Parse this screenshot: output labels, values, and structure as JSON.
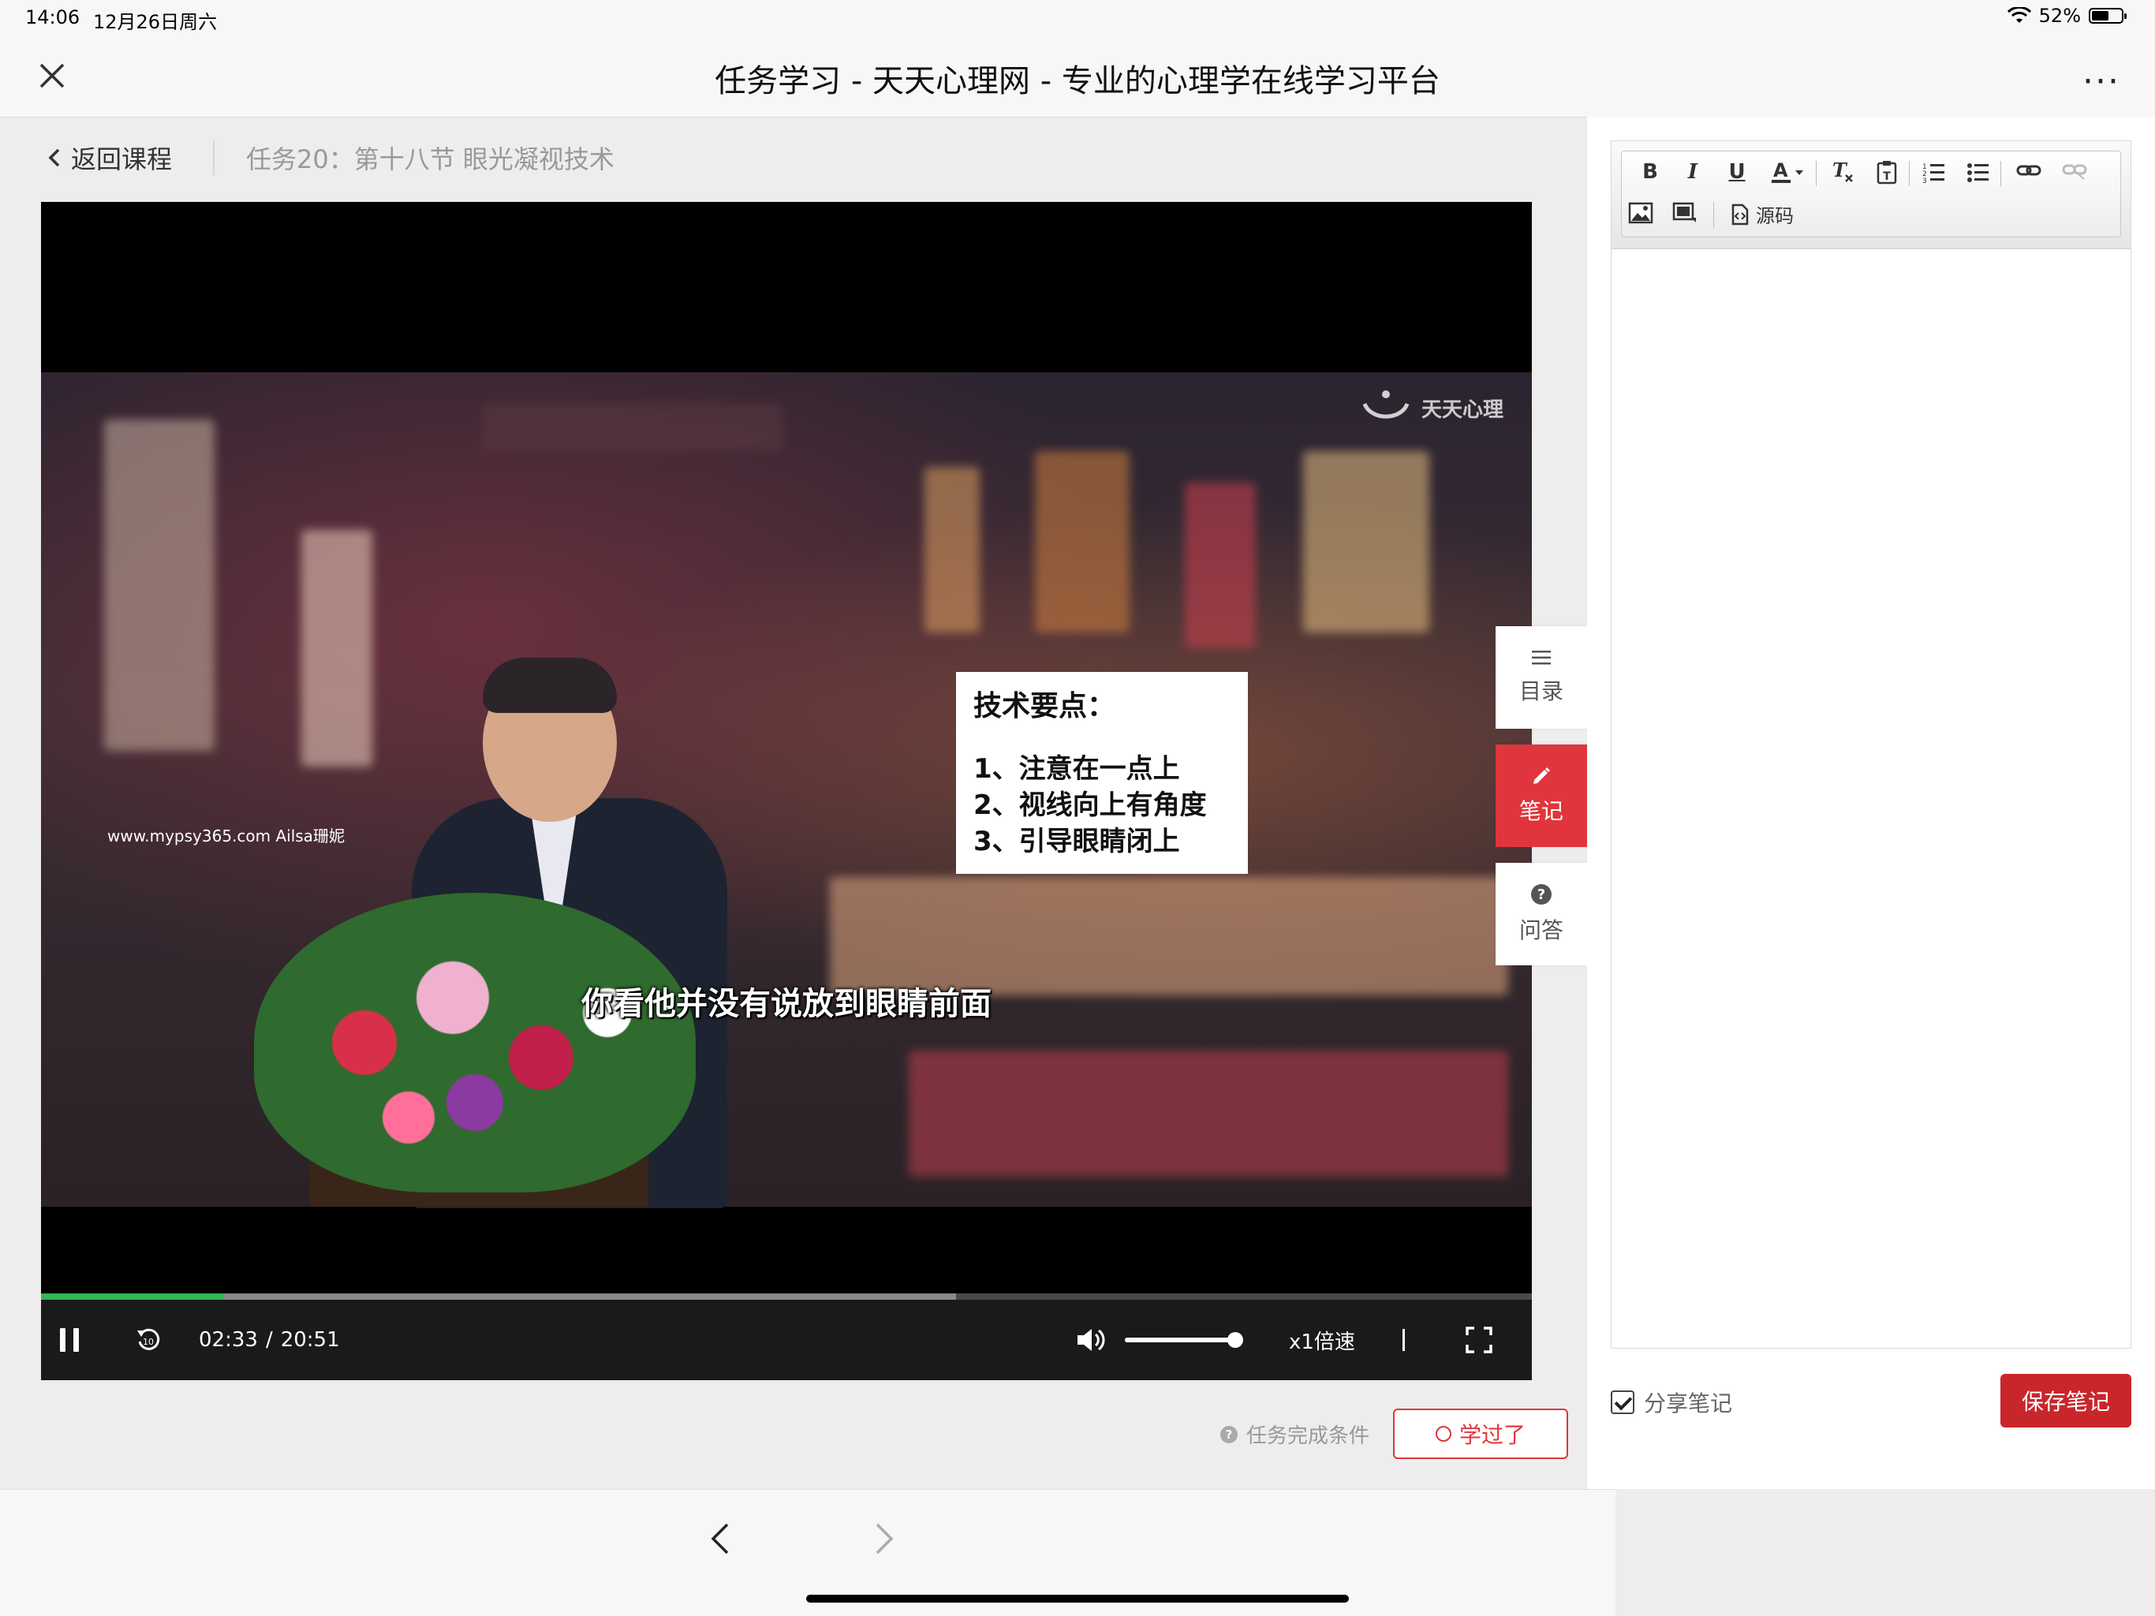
{
  "status": {
    "time": "14:06",
    "date": "12月26日周六",
    "battery": "52%"
  },
  "navbar": {
    "title": "任务学习 - 天天心理网 - 专业的心理学在线学习平台",
    "more": "···"
  },
  "breadcrumb": {
    "back_label": "返回课程",
    "task_title": "任务20：第十八节 眼光凝视技术"
  },
  "video": {
    "logo_text": "天天心理",
    "watermark": "www.mypsy365.com Ailsa珊妮",
    "slide": {
      "heading": "技术要点：",
      "points": [
        "1、注意在一点上",
        "2、视线向上有角度",
        "3、引导眼睛闭上"
      ]
    },
    "subtitle": "你看他并没有说放到眼睛前面",
    "current_time": "02:33",
    "time_sep": "/",
    "duration": "20:51",
    "played_fraction": 0.123,
    "buffered_fraction": 0.614,
    "volume_fraction": 1.0,
    "speed_label": "x1倍速",
    "accent_color": "#35b558"
  },
  "side_tabs": [
    {
      "label": "目录",
      "icon": "list-icon",
      "active": false
    },
    {
      "label": "笔记",
      "icon": "pencil-icon",
      "active": true
    },
    {
      "label": "问答",
      "icon": "question-icon",
      "active": false
    }
  ],
  "task": {
    "complete_condition": "任务完成条件",
    "learned_label": "学过了"
  },
  "notes": {
    "source_label": "源码",
    "share_label": "分享笔记",
    "share_checked": true,
    "save_label": "保存笔记",
    "brand_color": "#c9262c"
  }
}
